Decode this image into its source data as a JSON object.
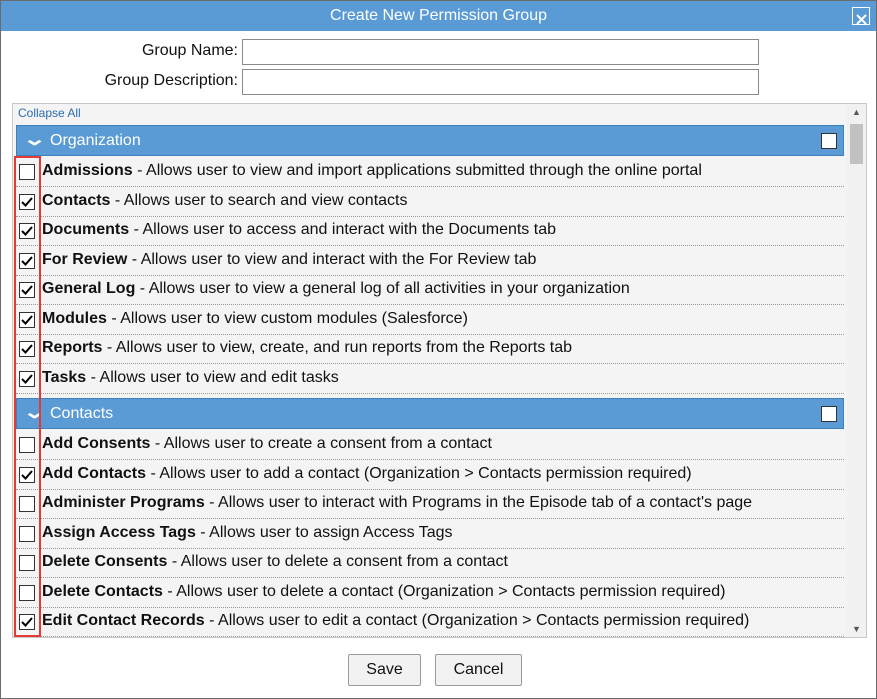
{
  "dialog": {
    "title": "Create New Permission Group"
  },
  "form": {
    "group_name_label": "Group Name:",
    "group_name_value": "",
    "group_description_label": "Group Description:",
    "group_description_value": ""
  },
  "panel": {
    "collapse_all": "Collapse All"
  },
  "groups": [
    {
      "title": "Organization",
      "checked": false,
      "items": [
        {
          "name": "Admissions",
          "desc": " - Allows user to view and import applications submitted through the online portal",
          "checked": false
        },
        {
          "name": "Contacts",
          "desc": " - Allows user to search and view contacts",
          "checked": true
        },
        {
          "name": "Documents",
          "desc": " - Allows user to access and interact with the Documents tab",
          "checked": true
        },
        {
          "name": "For Review",
          "desc": " - Allows user to view and interact with the For Review tab",
          "checked": true
        },
        {
          "name": "General Log",
          "desc": " - Allows user to view a general log of all activities in your organization",
          "checked": true
        },
        {
          "name": "Modules",
          "desc": " - Allows user to view custom modules (Salesforce)",
          "checked": true
        },
        {
          "name": "Reports",
          "desc": " - Allows user to view, create, and run reports from the Reports tab",
          "checked": true
        },
        {
          "name": "Tasks",
          "desc": " - Allows user to view and edit tasks",
          "checked": true
        }
      ]
    },
    {
      "title": "Contacts",
      "checked": false,
      "items": [
        {
          "name": "Add Consents",
          "desc": " - Allows user to create a consent from a contact",
          "checked": false
        },
        {
          "name": "Add Contacts",
          "desc": " - Allows user to add a contact (Organization > Contacts permission required)",
          "checked": true
        },
        {
          "name": "Administer Programs",
          "desc": " - Allows user to interact with Programs in the Episode tab of a contact's page",
          "checked": false
        },
        {
          "name": "Assign Access Tags",
          "desc": " - Allows user to assign Access Tags",
          "checked": false
        },
        {
          "name": "Delete Consents",
          "desc": " - Allows user to delete a consent from a contact",
          "checked": false
        },
        {
          "name": "Delete Contacts",
          "desc": " - Allows user to delete a contact (Organization > Contacts permission required)",
          "checked": false
        },
        {
          "name": "Edit Contact Records",
          "desc": " - Allows user to edit a contact (Organization > Contacts permission required)",
          "checked": true
        }
      ]
    }
  ],
  "footer": {
    "save_label": "Save",
    "cancel_label": "Cancel"
  },
  "icons": {
    "close": "close-icon",
    "chevron": "chevron-down-icon",
    "check": "checkmark-icon"
  },
  "colors": {
    "header": "#5a9bd5",
    "highlight": "#e53935"
  }
}
